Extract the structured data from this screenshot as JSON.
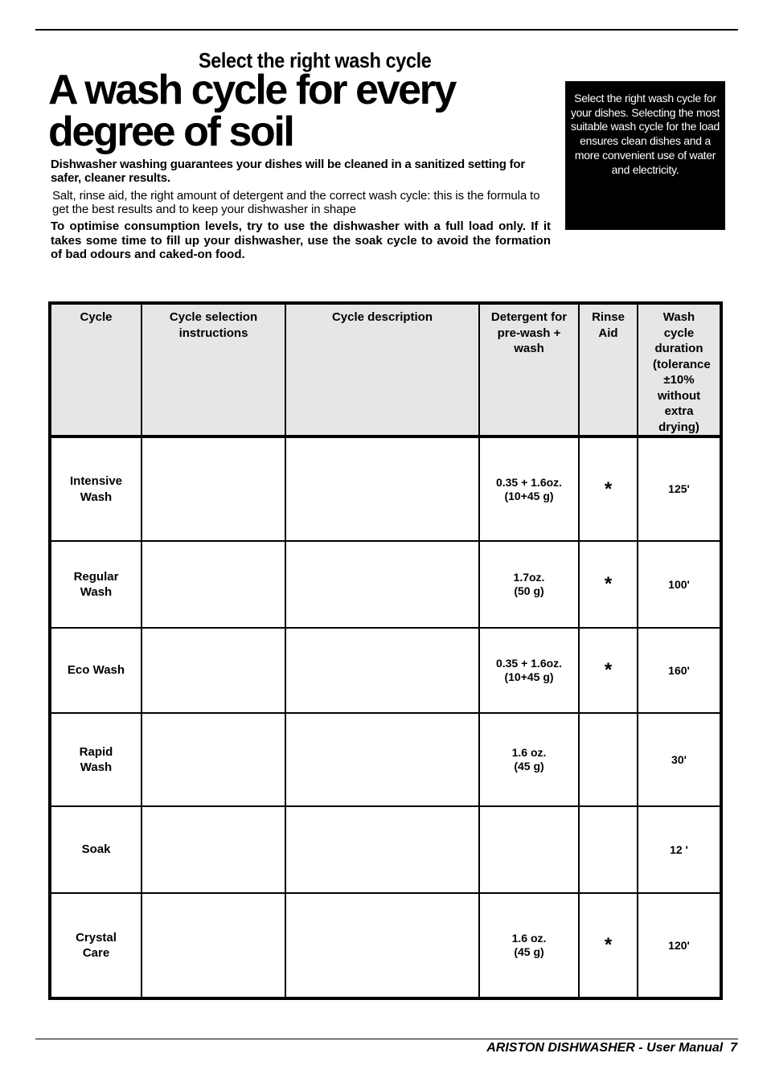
{
  "header": {
    "subtitle": "Select the right wash cycle",
    "title_line1": "A wash cycle for every",
    "title_line2": "degree of soil"
  },
  "intro": {
    "paragraph1": "Dishwasher washing guarantees your dishes will be cleaned in a sanitized setting for safer, cleaner results.",
    "paragraph2": "Salt, rinse aid, the right amount of detergent and the correct wash cycle: this is the formula to get the best results and to keep your dishwasher in shape",
    "paragraph3": "To optimise consumption levels, try to use the dishwasher with a full load only. If it takes some time to fill up your dishwasher, use the soak cycle to avoid the formation of bad odours and caked-on food."
  },
  "sidebox": {
    "text": "Select the right wash cycle for your dishes. Selecting the most suitable wash cycle for the load ensures clean dishes and a more convenient use of water and electricity."
  },
  "table": {
    "headers": {
      "cycle": "Cycle",
      "instructions": "Cycle selection instructions",
      "description": "Cycle description",
      "detergent": "Detergent for pre-wash + wash",
      "rinse_aid": "Rinse Aid",
      "duration": "Wash cycle duration (tolerance ±10% without extra drying)"
    },
    "rows": [
      {
        "cycle": "Intensive Wash",
        "instructions": "",
        "description": "",
        "detergent_oz": "0.35 + 1.6oz.",
        "detergent_g": "(10+45 g)",
        "rinse_aid": "*",
        "duration": "125'"
      },
      {
        "cycle": "Regular Wash",
        "instructions": "",
        "description": "",
        "detergent_oz": "1.7oz.",
        "detergent_g": "(50 g)",
        "rinse_aid": "*",
        "duration": "100'"
      },
      {
        "cycle": "Eco Wash",
        "instructions": "",
        "description": "",
        "detergent_oz": "0.35 + 1.6oz.",
        "detergent_g": "(10+45 g)",
        "rinse_aid": "*",
        "duration": "160'"
      },
      {
        "cycle": "Rapid Wash",
        "instructions": "",
        "description": "",
        "detergent_oz": "1.6 oz.",
        "detergent_g": "(45 g)",
        "rinse_aid": "",
        "duration": "30'"
      },
      {
        "cycle": "Soak",
        "instructions": "",
        "description": "",
        "detergent_oz": "",
        "detergent_g": "",
        "rinse_aid": "",
        "duration": "12 '"
      },
      {
        "cycle": "Crystal Care",
        "instructions": "",
        "description": "",
        "detergent_oz": "1.6 oz.",
        "detergent_g": "(45 g)",
        "rinse_aid": "*",
        "duration": "120'"
      }
    ]
  },
  "footer": {
    "text": "ARISTON DISHWASHER - User Manual",
    "page_number": "7"
  }
}
